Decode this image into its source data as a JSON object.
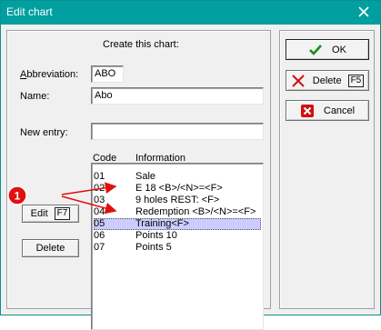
{
  "window": {
    "title": "Edit chart"
  },
  "form": {
    "heading": "Create this chart:",
    "abbreviation": {
      "label": "Abbreviation:",
      "value": "ABO"
    },
    "name": {
      "label": "Name:",
      "value": "Abo"
    },
    "new_entry": {
      "label": "New entry:",
      "value": ""
    }
  },
  "list": {
    "headers": {
      "code": "Code",
      "info": "Information"
    },
    "rows": [
      {
        "code": "01",
        "info": "Sale",
        "selected": false
      },
      {
        "code": "02",
        "info": "E 18 <B>/<N>=<F>",
        "selected": false
      },
      {
        "code": "03",
        "info": "9 holes REST: <F>",
        "selected": false
      },
      {
        "code": "04",
        "info": "Redemption <B>/<N>=<F>",
        "selected": false
      },
      {
        "code": "05",
        "info": "Training<F>",
        "selected": true
      },
      {
        "code": "06",
        "info": "Points 10",
        "selected": false
      },
      {
        "code": "07",
        "info": "Points 5",
        "selected": false
      }
    ]
  },
  "buttons": {
    "edit": {
      "label": "Edit",
      "key": "F7"
    },
    "delete_entry": {
      "label": "Delete"
    },
    "ok": {
      "label": "OK"
    },
    "delete": {
      "label": "Delete",
      "key": "F5"
    },
    "cancel": {
      "label": "Cancel"
    }
  },
  "annotation": {
    "badge": "1"
  },
  "colors": {
    "titlebar": "#019f9f",
    "selection": "#ccccff",
    "ok_check": "#1a8a1a",
    "delete_x": "#d01010",
    "cancel_x": "#d01010",
    "annotation": "#e01010"
  },
  "icons": {
    "close": "close-icon",
    "ok": "check-icon",
    "delete": "red-x-icon",
    "cancel": "cancel-icon"
  }
}
